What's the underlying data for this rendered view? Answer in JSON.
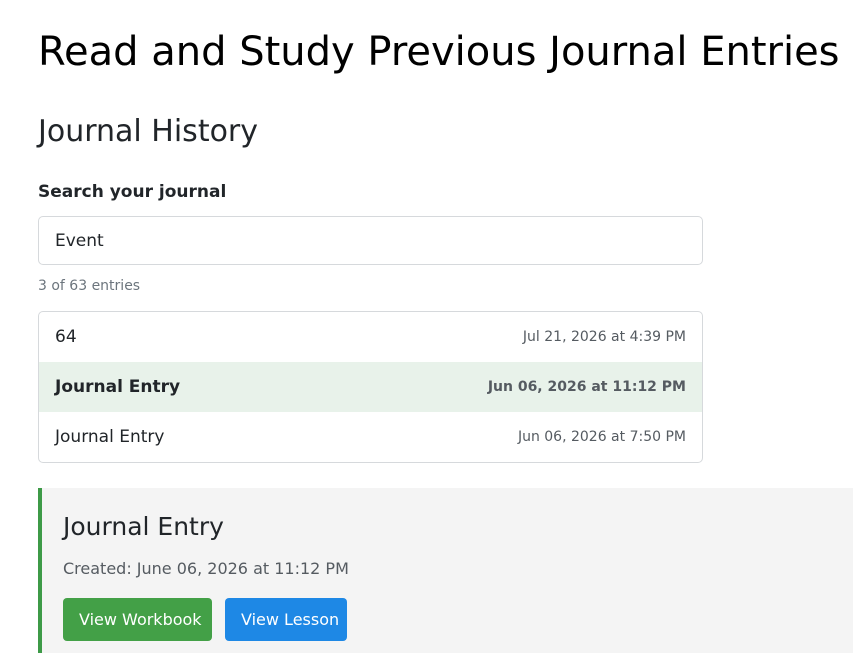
{
  "page": {
    "title": "Read and Study Previous Journal Entries"
  },
  "history": {
    "heading": "Journal History",
    "search": {
      "label": "Search your journal",
      "value": "Event",
      "placeholder": ""
    },
    "count_text": "3 of 63 entries",
    "entries": [
      {
        "title": "64",
        "date": "Jul 21, 2026 at 4:39 PM",
        "selected": false
      },
      {
        "title": "Journal Entry",
        "date": "Jun 06, 2026 at 11:12 PM",
        "selected": true
      },
      {
        "title": "Journal Entry",
        "date": "Jun 06, 2026 at 7:50 PM",
        "selected": false
      }
    ]
  },
  "detail": {
    "title": "Journal Entry",
    "created": "Created: June 06, 2026 at 11:12 PM",
    "workbook_button": "View Workbook",
    "lesson_button": "View Lesson"
  },
  "colors": {
    "accent_green": "#43a047",
    "accent_blue": "#1e88e5",
    "selected_row": "#e8f2ea",
    "panel_border": "#3d9a47"
  }
}
